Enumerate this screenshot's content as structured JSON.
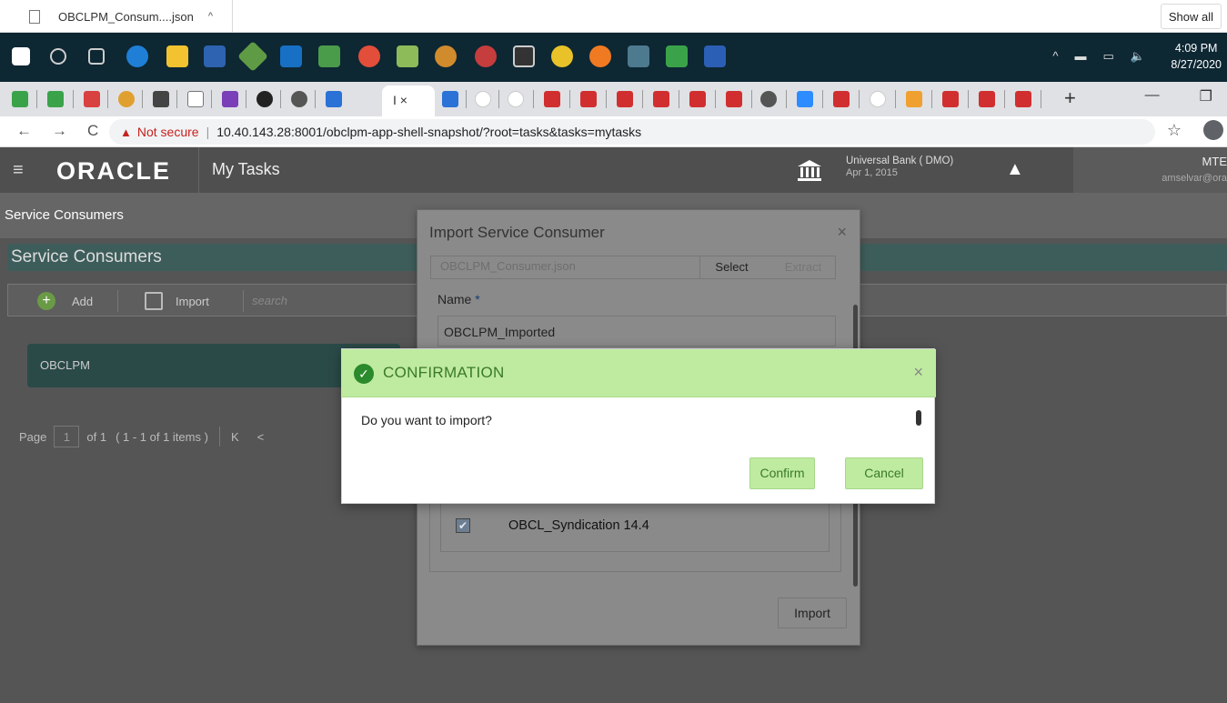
{
  "download_bar": {
    "file_name": "OBCLPM_Consum....json",
    "caret": "^",
    "show_all": "Show all"
  },
  "taskbar": {
    "icons": [
      "windows-start",
      "search",
      "task-view",
      "edge",
      "file-explorer",
      "powershell",
      "git",
      "outlook",
      "slack",
      "chrome",
      "notepad-plus",
      "settings",
      "paint",
      "terminal",
      "chrome-canary",
      "postman",
      "teams",
      "vs-code",
      "word"
    ],
    "tray": {
      "chevron": "^",
      "volume": "🔈"
    },
    "time": "4:09 PM",
    "date": "8/27/2020"
  },
  "browser": {
    "new_tab": "+",
    "active_tab_text": "I ×",
    "minimize": "—",
    "restore": "❐",
    "back": "←",
    "forward": "→",
    "reload": "C",
    "not_secure": "Not secure",
    "url_sep": "|",
    "url": "10.40.143.28:8001/obclpm-app-shell-snapshot/?root=tasks&tasks=mytasks",
    "star": "☆"
  },
  "app_header": {
    "hamburger": "≡",
    "logo": "ORACLE",
    "page": "My Tasks",
    "bank_name": "Universal Bank  ( DMO)",
    "bank_date": "Apr 1, 2015",
    "user_id": "MTE",
    "user_email": "amselvar@ora"
  },
  "page": {
    "breadcrumb": "Service Consumers",
    "title": "Service Consumers",
    "toolbar": {
      "add": "Add",
      "import": "Import",
      "search_placeholder": "search"
    },
    "card_label": "OBCLPM",
    "pager": {
      "page_label": "Page",
      "page_num": "1",
      "of": "of 1",
      "items": "( 1 - 1 of 1 items )",
      "first": "K",
      "prev": "<"
    }
  },
  "import_dialog": {
    "title": "Import Service Consumer",
    "close": "×",
    "file_name": "OBCLPM_Consumer.json",
    "select": "Select",
    "extract": "Extract",
    "name_label": "Name",
    "required": "*",
    "name_value": "OBCLPM_Imported",
    "item_checked": "✔",
    "item_label": "OBCL_Syndication 14.4",
    "import_button": "Import"
  },
  "confirm_dialog": {
    "icon": "✓",
    "title": "CONFIRMATION",
    "close": "×",
    "message": "Do you want to import?",
    "confirm": "Confirm",
    "cancel": "Cancel",
    "header_color": "#bfeba0",
    "text_color": "#3a7a2a"
  }
}
